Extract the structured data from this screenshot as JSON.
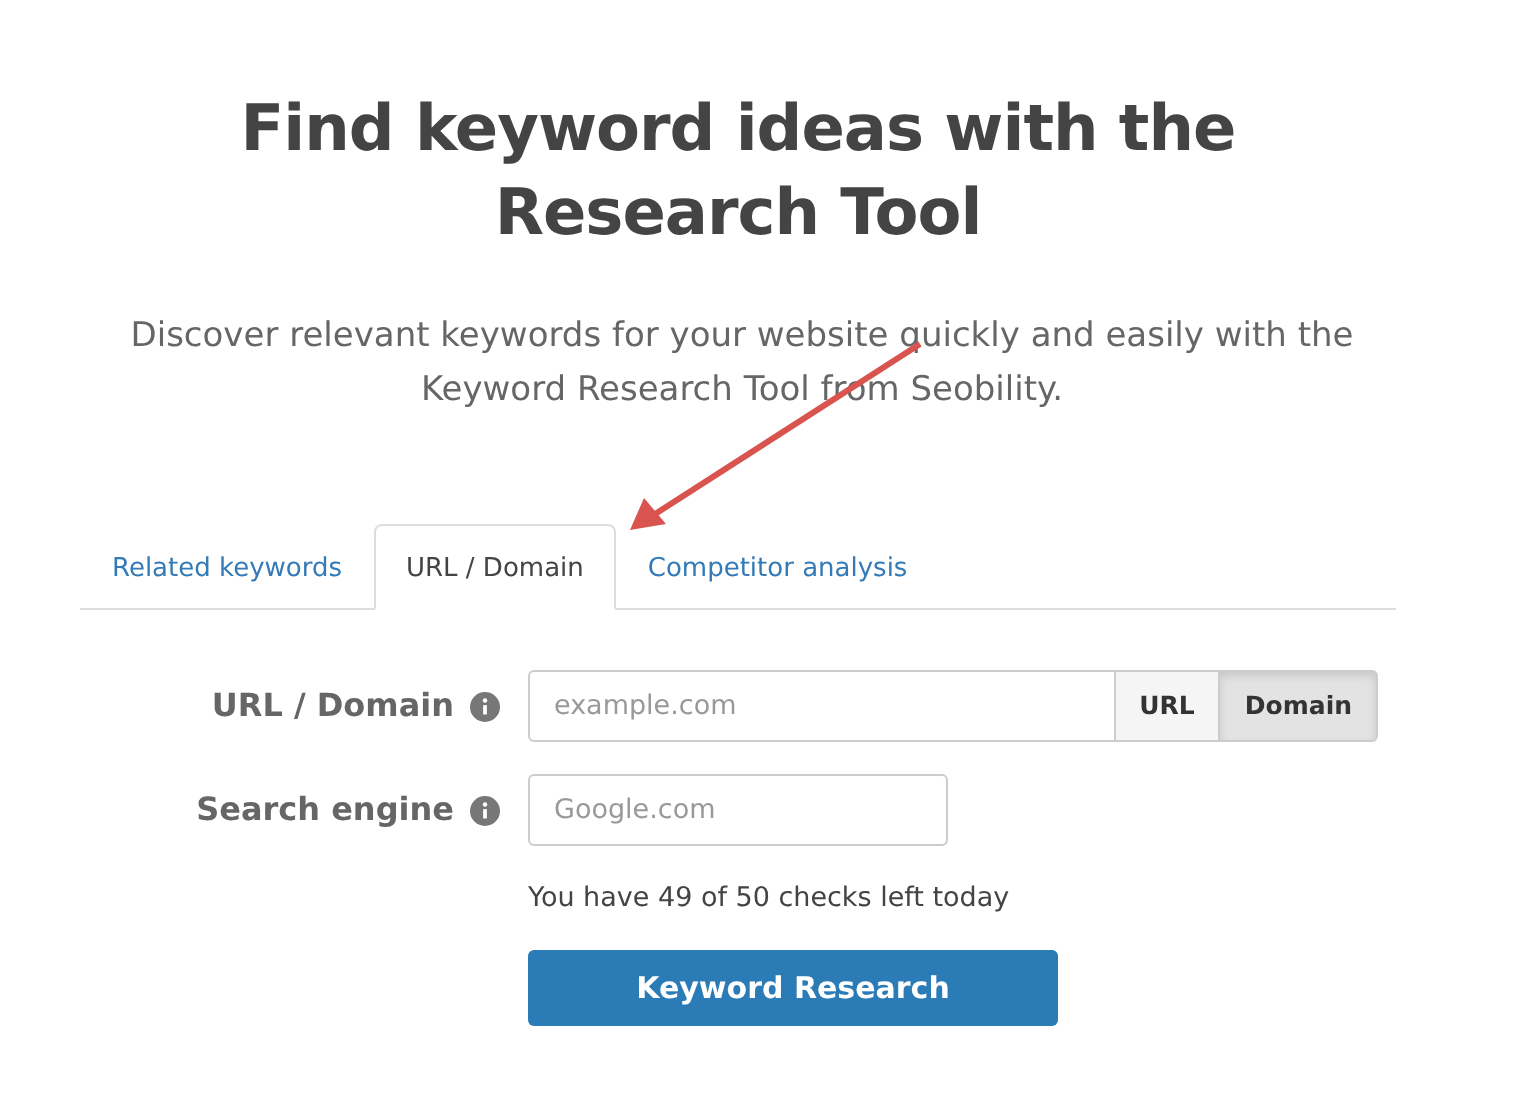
{
  "title": "Find keyword ideas with the Research Tool",
  "subtitle": "Discover relevant keywords for your website quickly and easily with the Keyword Research Tool from Seobility.",
  "tabs": [
    {
      "label": "Related keywords",
      "selected": false
    },
    {
      "label": "URL / Domain",
      "selected": true
    },
    {
      "label": "Competitor analysis",
      "selected": false
    }
  ],
  "url_field": {
    "label": "URL / Domain",
    "placeholder": "example.com",
    "modes": [
      {
        "label": "URL",
        "selected": false
      },
      {
        "label": "Domain",
        "selected": true
      }
    ]
  },
  "engine_field": {
    "label": "Search engine",
    "placeholder": "Google.com"
  },
  "checks_note": "You have 49 of 50 checks left today",
  "submit": "Keyword Research",
  "annotation": {
    "kind": "arrow",
    "color": "#d9534f"
  }
}
